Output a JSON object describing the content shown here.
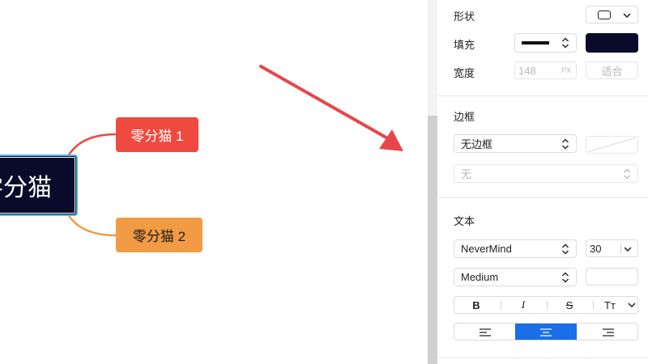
{
  "canvas": {
    "root_node": "零分猫",
    "child_nodes": [
      "零分猫 1",
      "零分猫 2"
    ],
    "colors": {
      "root": "#0a0a2a",
      "root_border": "#4fb6e6",
      "child_1": "#ef4a3f",
      "child_2": "#f29b45",
      "arrow": "#e8454a"
    }
  },
  "panel": {
    "shape": {
      "label": "形状",
      "value_icon": "rounded-rectangle-icon"
    },
    "fill": {
      "label": "填充",
      "line_style_icon": "solid-line-icon",
      "color": "#0a0a2a"
    },
    "width": {
      "label": "宽度",
      "placeholder": "148",
      "unit": "PX",
      "fit_label": "适合"
    },
    "border": {
      "title": "边框",
      "style_value": "无边框",
      "width_value": "无"
    },
    "text": {
      "title": "文本",
      "font_family": "NeverMind",
      "font_size": "30",
      "font_weight": "Medium",
      "bold_label": "B",
      "italic_label": "I",
      "strike_label": "S",
      "case_label": "Tт",
      "align_selected": "center"
    }
  }
}
